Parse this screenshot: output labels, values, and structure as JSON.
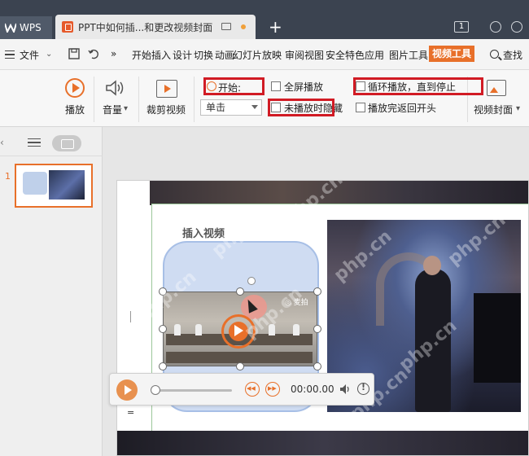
{
  "tabs": {
    "app": "WPS",
    "document": "PPT中如何插...和更改视频封面",
    "new_tab": "+",
    "window_count": "1"
  },
  "menu": {
    "file": "文件",
    "items": [
      "开始",
      "插入",
      "设计",
      "切换",
      "动画",
      "幻灯片放映",
      "审阅",
      "视图",
      "安全",
      "特色应用",
      "图片工具"
    ],
    "active_tab": "视频工具",
    "search": "查找"
  },
  "ribbon": {
    "play": "播放",
    "volume": "音量",
    "trim": "裁剪视频",
    "start_label": "开始:",
    "start_value": "单击",
    "fullscreen": "全屏播放",
    "hide_when_not_playing": "未播放时隐藏",
    "loop": "循环播放，直到停止",
    "rewind_after": "播放完返回开头",
    "cover": "视频封面"
  },
  "panel": {
    "slide_number": "1"
  },
  "slide": {
    "heading": "插入视频",
    "watermark": "php.cn",
    "inner_video_tag": "◎ 麦拍"
  },
  "player": {
    "time": "00:00.00",
    "dash": "="
  },
  "colors": {
    "accent": "#e8702a",
    "highlight_box": "#d11b24",
    "tabbar": "#3b4350"
  }
}
